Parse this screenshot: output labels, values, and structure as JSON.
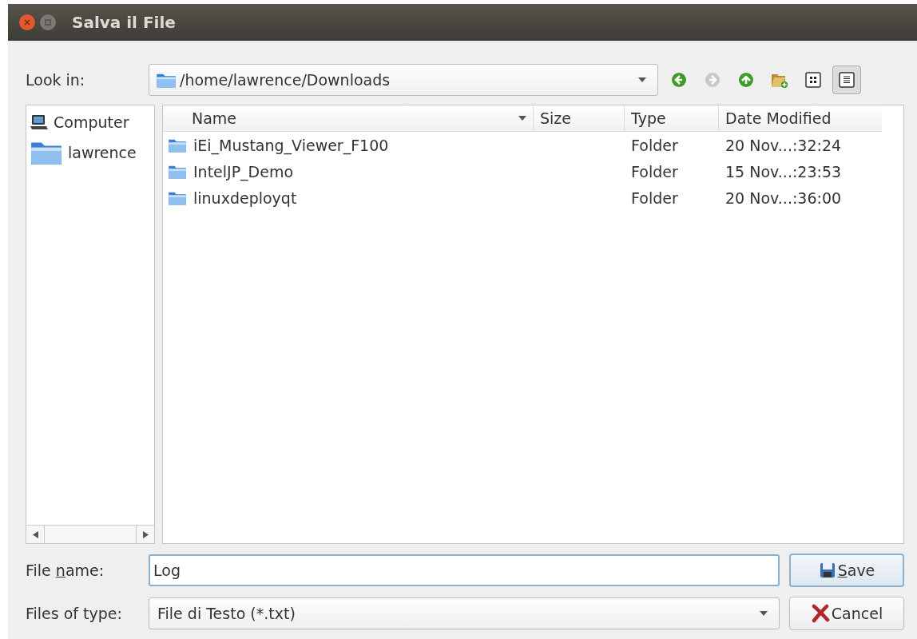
{
  "window": {
    "title": "Salva il File"
  },
  "look_in": {
    "label": "Look in:",
    "path": "/home/lawrence/Downloads"
  },
  "toolbar": [
    {
      "kind": "back",
      "disabled": false,
      "selected": false
    },
    {
      "kind": "forward",
      "disabled": true,
      "selected": false
    },
    {
      "kind": "up",
      "disabled": false,
      "selected": false
    },
    {
      "kind": "new_folder",
      "disabled": false,
      "selected": false
    },
    {
      "kind": "icon_view",
      "disabled": false,
      "selected": false
    },
    {
      "kind": "detail_view",
      "disabled": false,
      "selected": true
    }
  ],
  "sidebar": {
    "items": [
      {
        "kind": "computer",
        "label": "Computer"
      },
      {
        "kind": "folder",
        "label": "lawrence"
      }
    ]
  },
  "table": {
    "columns": [
      {
        "label": "Name",
        "sorted": true
      },
      {
        "label": "Size",
        "sorted": false
      },
      {
        "label": "Type",
        "sorted": false
      },
      {
        "label": "Date Modified",
        "sorted": false
      }
    ],
    "rows": [
      {
        "name": "iEi_Mustang_Viewer_F100",
        "type": "Folder",
        "date": "20 Nov...:32:24"
      },
      {
        "name": "IntelJP_Demo",
        "type": "Folder",
        "date": "15 Nov...:23:53"
      },
      {
        "name": "linuxdeployqt",
        "type": "Folder",
        "date": "20 Nov...:36:00"
      }
    ]
  },
  "file_name": {
    "label": {
      "before": "File ",
      "key": "n",
      "after": "ame:"
    },
    "value": "Log"
  },
  "file_type": {
    "label": "Files of type:",
    "value": "File di Testo (*.txt)"
  },
  "buttons": [
    {
      "kind": "save",
      "label": {
        "key": "S",
        "after": "ave"
      }
    },
    {
      "kind": "cancel",
      "label": {
        "after": "Cancel"
      }
    }
  ]
}
